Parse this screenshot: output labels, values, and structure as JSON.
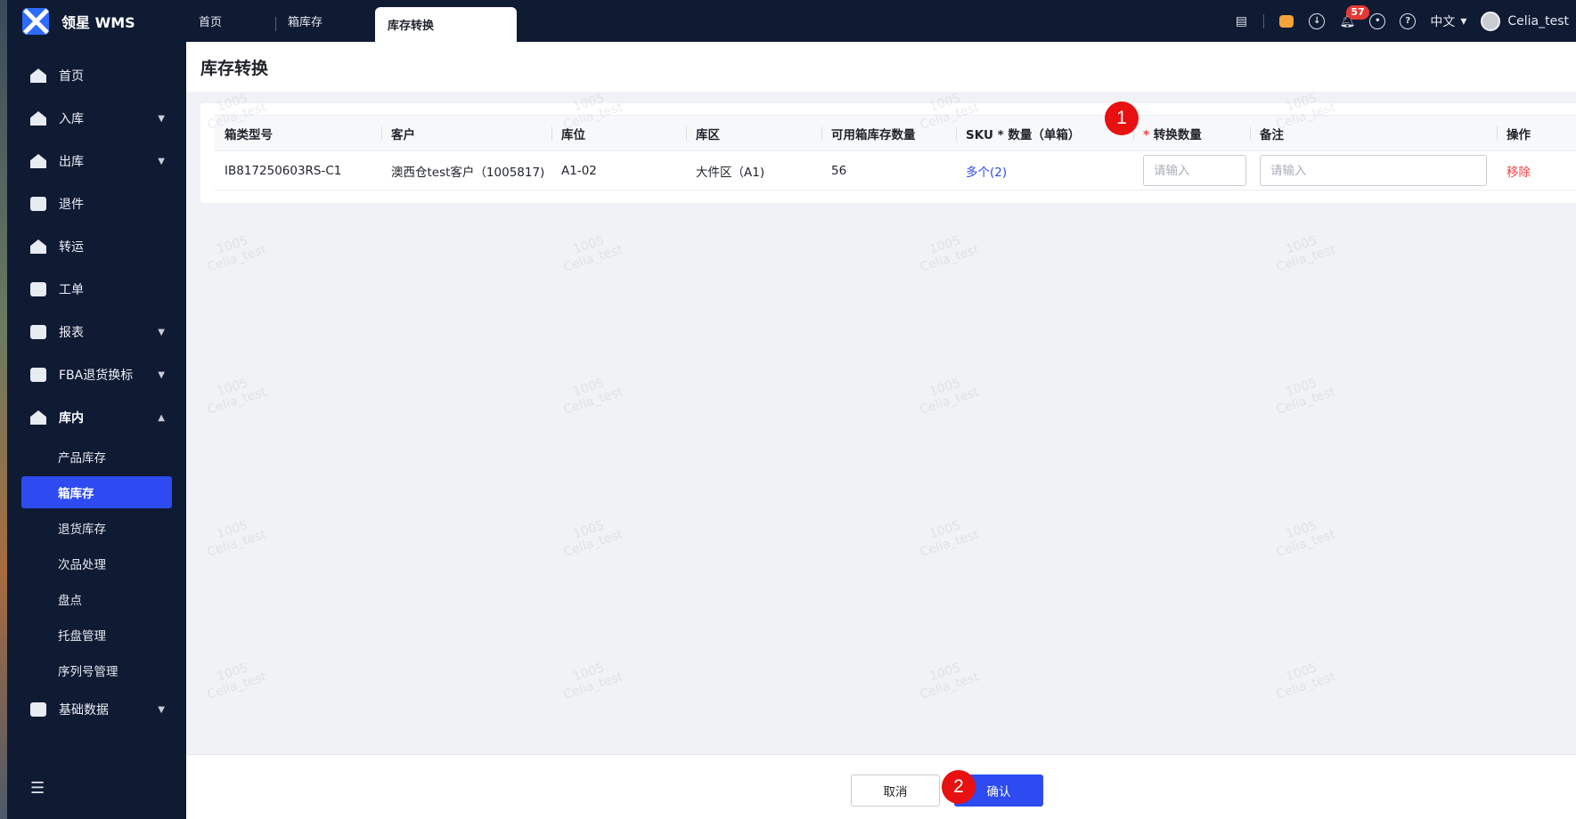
{
  "app": {
    "title": "领星 WMS"
  },
  "top_tabs": [
    {
      "label": "首页"
    },
    {
      "label": "箱库存"
    },
    {
      "label": "库存转换"
    }
  ],
  "header": {
    "notification_count": "57",
    "language": "中文",
    "username": "Celia_test",
    "icons": [
      "archive-icon",
      "robot-icon",
      "download-icon",
      "bell-icon",
      "settings-icon",
      "help-icon"
    ]
  },
  "sidebar": {
    "items": [
      {
        "label": "首页",
        "icon": "home-icon"
      },
      {
        "label": "入库",
        "icon": "inbound-icon",
        "expandable": true
      },
      {
        "label": "出库",
        "icon": "outbound-icon",
        "expandable": true
      },
      {
        "label": "退件",
        "icon": "return-icon"
      },
      {
        "label": "转运",
        "icon": "transfer-icon"
      },
      {
        "label": "工单",
        "icon": "work-order-icon"
      },
      {
        "label": "报表",
        "icon": "report-icon",
        "expandable": true
      },
      {
        "label": "FBA退货换标",
        "icon": "amazon-icon",
        "expandable": true
      },
      {
        "label": "库内",
        "icon": "warehouse-icon",
        "expanded": true
      }
    ],
    "sub_items": [
      {
        "label": "产品库存"
      },
      {
        "label": "箱库存",
        "active": true
      },
      {
        "label": "退货库存"
      },
      {
        "label": "次品处理"
      },
      {
        "label": "盘点"
      },
      {
        "label": "托盘管理"
      },
      {
        "label": "序列号管理"
      }
    ],
    "bottom_item": {
      "label": "基础数据",
      "icon": "database-icon"
    }
  },
  "page": {
    "title": "库存转换"
  },
  "table": {
    "columns": [
      "箱类型号",
      "客户",
      "库位",
      "库区",
      "可用箱库存数量",
      "SKU * 数量（单箱）",
      "转换数量",
      "备注",
      "操作"
    ],
    "required_mark": "*",
    "rows": [
      {
        "box_type": "IB817250603RS-C1",
        "customer": "澳西仓test客户（1005817)",
        "location": "A1-02",
        "area": "大件区（A1)",
        "available_qty": "56",
        "sku_qty": "多个(2)",
        "convert_qty_placeholder": "请输入",
        "remark_placeholder": "请输入",
        "action": "移除"
      }
    ]
  },
  "markers": [
    "1",
    "2"
  ],
  "footer": {
    "cancel": "取消",
    "confirm": "确认"
  },
  "watermark": {
    "line1": "1005",
    "line2": "Celia_test"
  }
}
